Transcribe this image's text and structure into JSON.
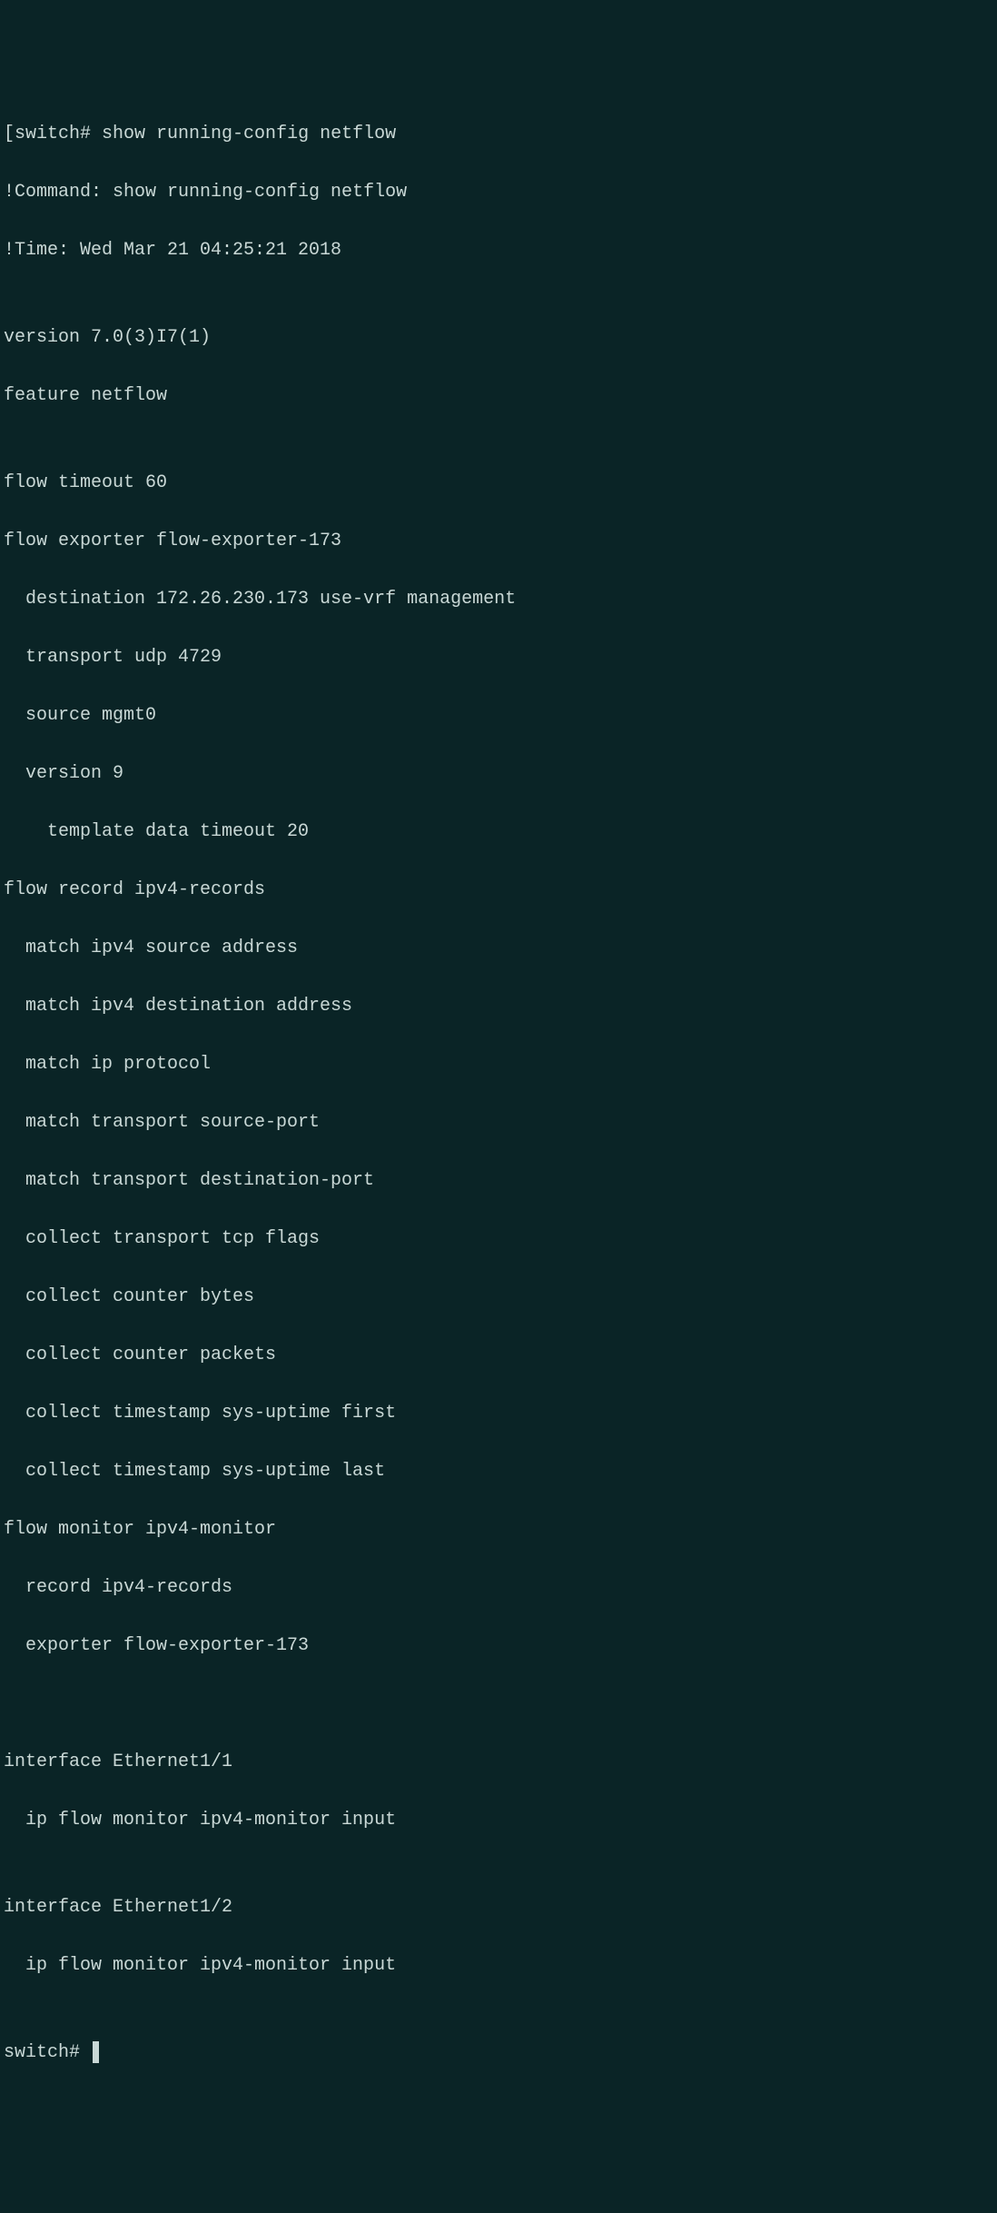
{
  "terminal": {
    "prompt1_bracket": "[",
    "prompt1_host": "switch# ",
    "prompt1_cmd": "show running-config netflow",
    "blank": "",
    "meta_cmd": "!Command: show running-config netflow",
    "meta_time": "!Time: Wed Mar 21 04:25:21 2018",
    "version": "version 7.0(3)I7(1)",
    "feature": "feature netflow",
    "flow_timeout": "flow timeout 60",
    "exporter_hdr": "flow exporter flow-exporter-173",
    "exporter_dest": "destination 172.26.230.173 use-vrf management",
    "exporter_transport": "transport udp 4729",
    "exporter_source": "source mgmt0",
    "exporter_version": "version 9",
    "exporter_template": "template data timeout 20",
    "record_hdr": "flow record ipv4-records",
    "record_m1": "match ipv4 source address",
    "record_m2": "match ipv4 destination address",
    "record_m3": "match ip protocol",
    "record_m4": "match transport source-port",
    "record_m5": "match transport destination-port",
    "record_c1": "collect transport tcp flags",
    "record_c2": "collect counter bytes",
    "record_c3": "collect counter packets",
    "record_c4": "collect timestamp sys-uptime first",
    "record_c5": "collect timestamp sys-uptime last",
    "monitor_hdr": "flow monitor ipv4-monitor",
    "monitor_record": "record ipv4-records",
    "monitor_exporter": "exporter flow-exporter-173",
    "iface1_hdr": "interface Ethernet1/1",
    "iface1_mon": "ip flow monitor ipv4-monitor input",
    "iface2_hdr": "interface Ethernet1/2",
    "iface2_mon": "ip flow monitor ipv4-monitor input",
    "prompt2": "switch# "
  }
}
